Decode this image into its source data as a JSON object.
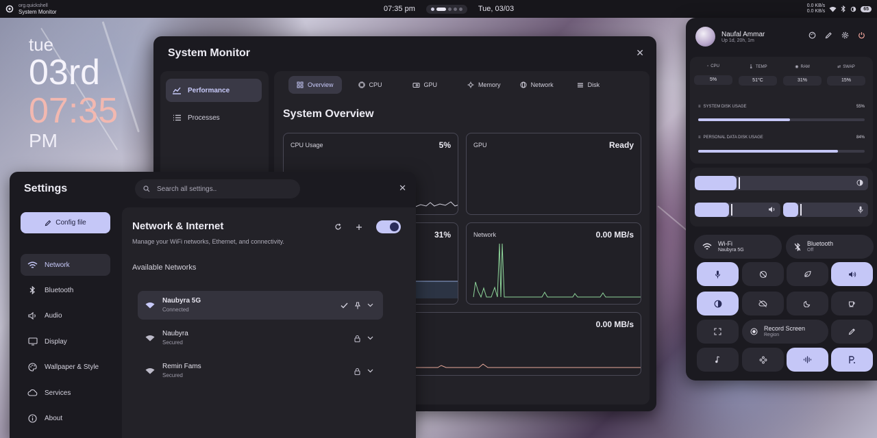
{
  "topbar": {
    "app_sub": "org.quickshell",
    "app_name": "System Monitor",
    "time": "07:35 pm",
    "date": "Tue, 03/03",
    "net_up": "0.0 KB/s",
    "net_down": "0.0 KB/s",
    "battery": "65"
  },
  "desktop_clock": {
    "day": "tue",
    "date": "03rd",
    "time": "07:35",
    "ampm": "PM"
  },
  "sysmon": {
    "title": "System Monitor",
    "sidebar": [
      {
        "label": "Performance",
        "icon": "chart-icon"
      },
      {
        "label": "Processes",
        "icon": "list-icon"
      }
    ],
    "tabs": [
      {
        "label": "Overview",
        "icon": "grid-icon"
      },
      {
        "label": "CPU",
        "icon": "cpu-icon"
      },
      {
        "label": "GPU",
        "icon": "gpu-icon"
      },
      {
        "label": "Memory",
        "icon": "memory-icon"
      },
      {
        "label": "Network",
        "icon": "globe-icon"
      },
      {
        "label": "Disk",
        "icon": "disk-icon"
      }
    ],
    "heading": "System Overview",
    "cards": {
      "cpu": {
        "label": "CPU Usage",
        "value": "5%"
      },
      "gpu": {
        "label": "GPU",
        "value": "Ready"
      },
      "memory": {
        "value": "31%"
      },
      "network": {
        "label": "Network",
        "value": "0.00 MB/s"
      },
      "disk": {
        "value": "0.00 MB/s"
      }
    },
    "colors": {
      "cpu": "#d7d5e2",
      "memory": "#8fa6d8",
      "network": "#8fd69b",
      "disk": "#e6a89a"
    }
  },
  "settings": {
    "title": "Settings",
    "search_placeholder": "Search all settings..",
    "config_button": "Config file",
    "nav": [
      {
        "label": "Network",
        "icon": "wifi-icon"
      },
      {
        "label": "Bluetooth",
        "icon": "bluetooth-icon"
      },
      {
        "label": "Audio",
        "icon": "speaker-icon"
      },
      {
        "label": "Display",
        "icon": "monitor-icon"
      },
      {
        "label": "Wallpaper & Style",
        "icon": "palette-icon"
      },
      {
        "label": "Services",
        "icon": "cloud-icon"
      },
      {
        "label": "About",
        "icon": "info-icon"
      }
    ],
    "panel": {
      "title": "Network & Internet",
      "subtitle": "Manage your WiFi networks, Ethernet, and connectivity.",
      "available": "Available Networks",
      "wifi_enabled": true,
      "networks": [
        {
          "name": "Naubyra 5G",
          "status": "Connected"
        },
        {
          "name": "Naubyra",
          "status": "Secured"
        },
        {
          "name": "Remin Fams",
          "status": "Secured"
        }
      ]
    }
  },
  "quickpanel": {
    "user_name": "Naufal Ammar",
    "uptime": "Up 1d, 20h, 1m",
    "stats": [
      {
        "label": "CPU",
        "value": "5%"
      },
      {
        "label": "TEMP",
        "value": "51°C"
      },
      {
        "label": "RAM",
        "value": "31%"
      },
      {
        "label": "SWAP",
        "value": "15%"
      }
    ],
    "disks": [
      {
        "label": "SYSTEM DISK USAGE",
        "percent": "55%",
        "fraction": 0.55
      },
      {
        "label": "PERSONAL DATA DISK USAGE",
        "percent": "84%",
        "fraction": 0.84
      }
    ],
    "sliders": {
      "brightness": 0.24,
      "volume": 0.4,
      "mic": 0.18
    },
    "wifi": {
      "label": "Wi-Fi",
      "sub": "Naubyra 5G"
    },
    "bluetooth": {
      "label": "Bluetooth",
      "sub": "Off"
    },
    "record": {
      "label": "Record Screen",
      "sub": "Region"
    },
    "accent": "#c5c7f7"
  }
}
